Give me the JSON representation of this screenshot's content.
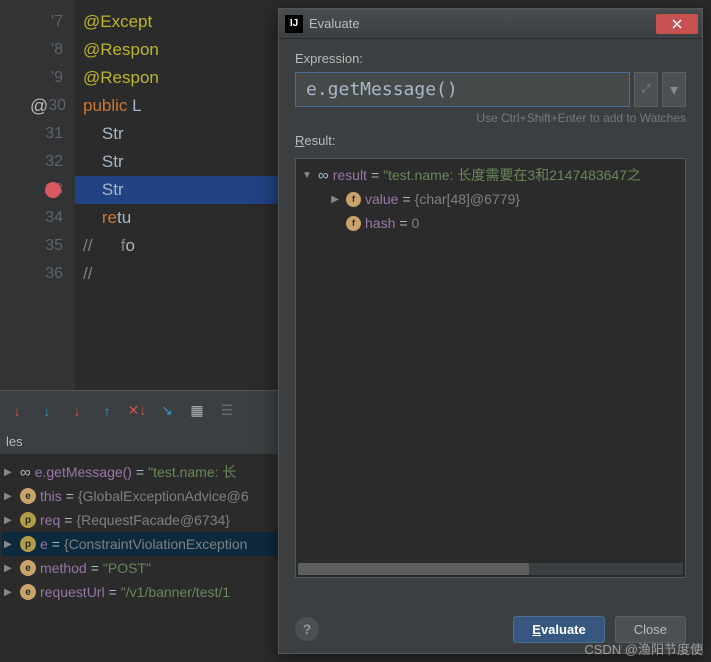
{
  "editor": {
    "lines": [
      {
        "num": "'7",
        "code": "@Except",
        "cls": "ann"
      },
      {
        "num": "'8",
        "code": "@Respon",
        "cls": "ann"
      },
      {
        "num": "'9",
        "code": "@Respon",
        "cls": "ann"
      },
      {
        "num": "30",
        "at": true,
        "code": "public ",
        "cls": "kw",
        "tail": "L"
      },
      {
        "num": "31",
        "code": "    St",
        "cls": "txt",
        "tail": "r"
      },
      {
        "num": "32",
        "code": "    St",
        "cls": "txt",
        "tail": "r"
      },
      {
        "num": "33",
        "bp": true,
        "hl": true,
        "code": "    St",
        "cls": "txt",
        "tail": "r"
      },
      {
        "num": "34",
        "code": "    re",
        "cls": "kw",
        "tail": "tu"
      },
      {
        "num": "35",
        "code": "//      f",
        "cls": "cmt",
        "tail": "o"
      },
      {
        "num": "36",
        "code": "//",
        "cls": "cmt"
      }
    ]
  },
  "tabs": {
    "label": "les"
  },
  "variables": [
    {
      "icon": "inf",
      "name": "e.getMessage()",
      "eq": " = ",
      "val": "\"test.name: 长",
      "valcls": "vstr",
      "chev": "▶"
    },
    {
      "icon": "e",
      "name": "this",
      "eq": " = ",
      "val": "{GlobalExceptionAdvice@6",
      "valcls": "vobj",
      "chev": "▶"
    },
    {
      "icon": "p",
      "name": "req",
      "eq": " = ",
      "val": "{RequestFacade@6734}",
      "valcls": "vobj",
      "chev": "▶"
    },
    {
      "icon": "p",
      "name": "e",
      "eq": " = ",
      "val": "{ConstraintViolationException",
      "valcls": "vobj",
      "chev": "▶",
      "sel": true
    },
    {
      "icon": "e",
      "name": "method",
      "eq": " = ",
      "val": "\"POST\"",
      "valcls": "vstr",
      "chev": "▶"
    },
    {
      "icon": "e",
      "name": "requestUrl",
      "eq": " = ",
      "val": "\"/v1/banner/test/1",
      "valcls": "vstr",
      "chev": "▶"
    }
  ],
  "dialog": {
    "title": "Evaluate",
    "exprLabel": "Expression:",
    "exprValue": "e.getMessage()",
    "hint": "Use Ctrl+Shift+Enter to add to Watches",
    "resultLabel": "Result:",
    "result": {
      "name": "result",
      "eq": " = ",
      "val": "\"test.name: 长度需要在3和2147483647之",
      "children": [
        {
          "chev": "▶",
          "name": "value",
          "eq": " = ",
          "val": "{char[48]@6779}"
        },
        {
          "chev": "",
          "name": "hash",
          "eq": " = ",
          "val": "0"
        }
      ]
    },
    "evalBtn": "Evaluate",
    "closeBtn": "Close",
    "help": "?"
  },
  "watermark": "CSDN @渔阳节度使"
}
